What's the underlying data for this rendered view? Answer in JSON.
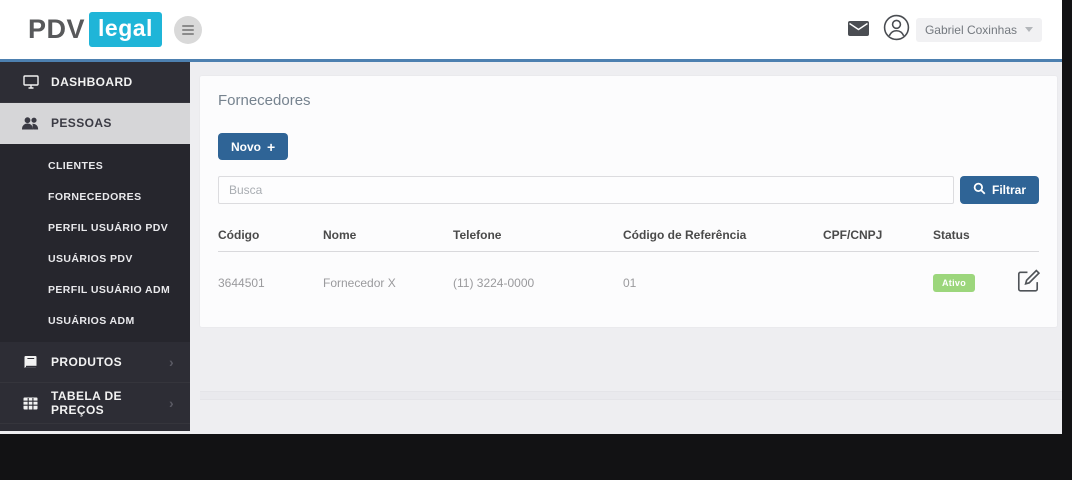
{
  "header": {
    "logo_part1": "PDV",
    "logo_part2": "legal",
    "user_name": "Gabriel Coxinhas"
  },
  "sidebar": {
    "dashboard": "DASHBOARD",
    "pessoas": "PESSOAS",
    "submenu": [
      "CLIENTES",
      "FORNECEDORES",
      "PERFIL USUÁRIO PDV",
      "USUÁRIOS PDV",
      "PERFIL USUÁRIO ADM",
      "USUÁRIOS ADM"
    ],
    "produtos": "PRODUTOS",
    "tabela_precos": "TABELA DE PREÇOS",
    "chevron": "›"
  },
  "main": {
    "title": "Fornecedores",
    "new_button_label": "Novo",
    "new_button_icon": "+",
    "search_placeholder": "Busca",
    "filter_button_label": "Filtrar",
    "table": {
      "headers": [
        "Código",
        "Nome",
        "Telefone",
        "Código de Referência",
        "CPF/CNPJ",
        "Status"
      ],
      "rows": [
        {
          "codigo": "3644501",
          "nome": "Fornecedor X",
          "telefone": "(11) 3224-0000",
          "codigo_referencia": "01",
          "cpf_cnpj": "",
          "status": "Ativo"
        }
      ]
    }
  },
  "colors": {
    "logo_accent": "#1fb5d8",
    "primary_button": "#2f6496",
    "header_underline": "#4d80b0",
    "sidebar_bg": "#2d2d35",
    "sidebar_active_bg": "#d6d6d8",
    "status_active_bg": "#9cd67c"
  }
}
